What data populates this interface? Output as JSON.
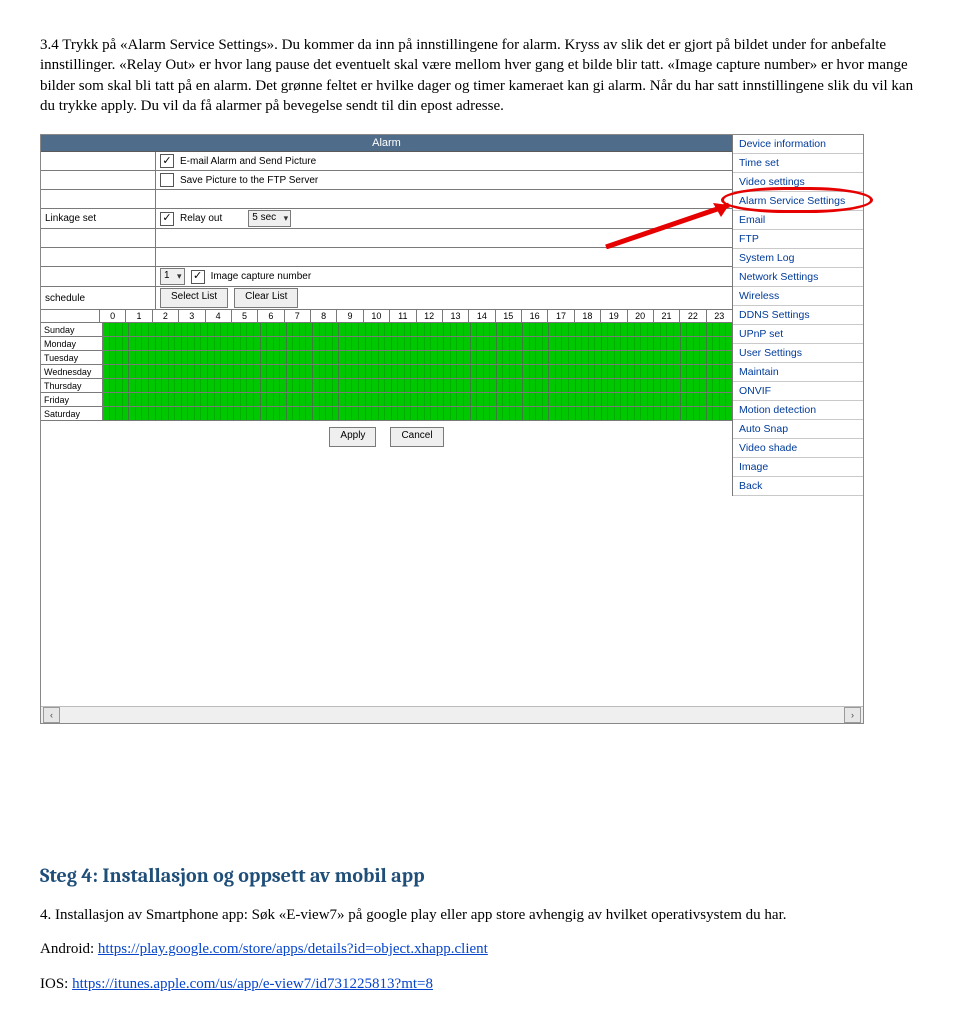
{
  "intro": {
    "secnum": "3.4",
    "text": "Trykk på «Alarm Service Settings». Du kommer da inn på innstillingene for alarm. Kryss av slik det er gjort på bildet under for anbefalte innstillinger. «Relay Out» er hvor lang pause det eventuelt skal være mellom hver gang et bilde blir tatt. «Image capture number» er hvor mange bilder som skal bli tatt på en alarm. Det grønne feltet er hvilke dager og timer kameraet kan gi alarm. Når du har satt innstillingene slik du vil kan du trykke apply. Du vil da få alarmer på bevegelse sendt til din epost adresse."
  },
  "alarm_header": "Alarm",
  "linkage_label": "Linkage set",
  "schedule_label": "schedule",
  "cb_email": "E-mail Alarm and Send Picture",
  "cb_ftp": "Save Picture to the FTP Server",
  "cb_relay": "Relay out",
  "relay_sel": "5 sec",
  "cb_imgcap": "Image capture number",
  "imgcap_sel": "1",
  "btn_selectlist": "Select List",
  "btn_clearlist": "Clear List",
  "btn_apply": "Apply",
  "btn_cancel": "Cancel",
  "hours": [
    "0",
    "1",
    "2",
    "3",
    "4",
    "5",
    "6",
    "7",
    "8",
    "9",
    "10",
    "11",
    "12",
    "13",
    "14",
    "15",
    "16",
    "17",
    "18",
    "19",
    "20",
    "21",
    "22",
    "23"
  ],
  "days": [
    "Sunday",
    "Monday",
    "Tuesday",
    "Wednesday",
    "Thursday",
    "Friday",
    "Saturday"
  ],
  "sidebar": {
    "items": [
      "Device information",
      "Time set",
      "Video settings",
      "Alarm Service Settings",
      "Email",
      "FTP",
      "System Log",
      "Network Settings",
      "Wireless",
      "DDNS Settings",
      "UPnP set",
      "User Settings",
      "Maintain",
      "ONVIF",
      "Motion detection",
      "Auto Snap",
      "Video shade",
      "Image",
      "Back"
    ]
  },
  "step_heading": "Steg 4: Installasjon og oppsett av mobil app",
  "p_install": "4. Installasjon av Smartphone app: Søk «E-view7» på google play eller app store avhengig av hvilket operativsystem du har.",
  "android_label": "Android: ",
  "android_link": "https://play.google.com/store/apps/details?id=object.xhapp.client",
  "ios_label": "IOS: ",
  "ios_link": "https://itunes.apple.com/us/app/e-view7/id731225813?mt=8"
}
